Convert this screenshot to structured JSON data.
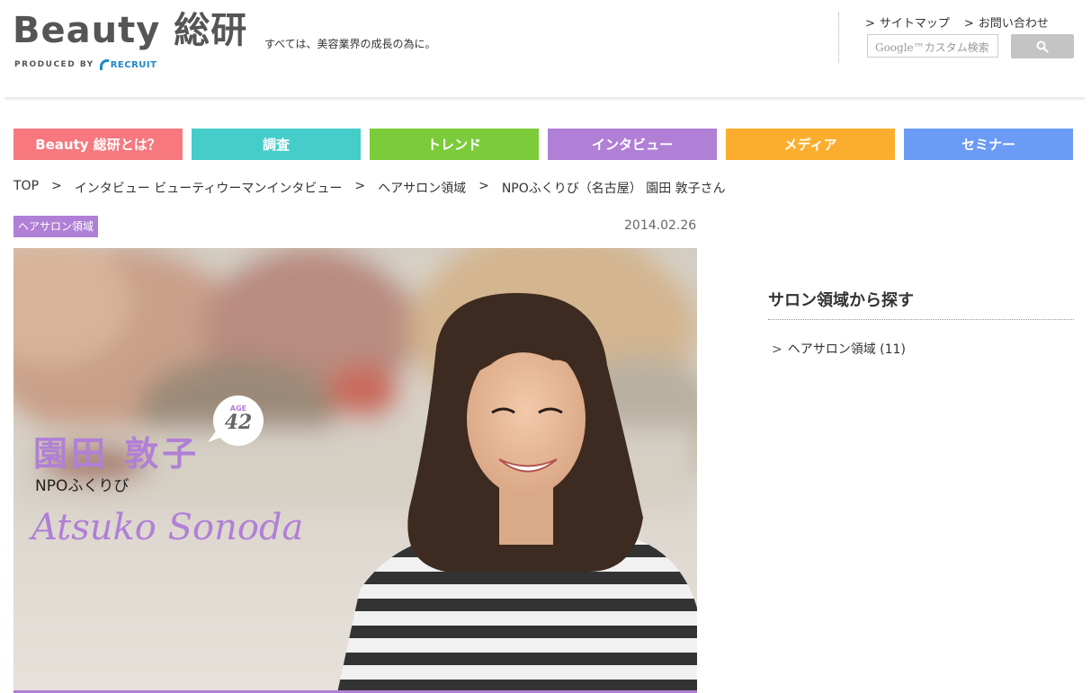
{
  "header": {
    "logo": "Beauty 総研",
    "produced_by": "PRODUCED BY",
    "recruit": "RECRUIT",
    "tagline": "すべては、美容業界の成長の為に。",
    "links": [
      {
        "arrow": ">",
        "label": "サイトマップ"
      },
      {
        "arrow": ">",
        "label": "お問い合わせ"
      }
    ],
    "search_placeholder": "Google™カスタム検索",
    "search_icon": "search-icon"
  },
  "nav": [
    {
      "label": "Beauty 総研とは？",
      "color": "#f7787f"
    },
    {
      "label": "調査",
      "color": "#45cdc9"
    },
    {
      "label": "トレンド",
      "color": "#7ccb3a"
    },
    {
      "label": "インタビュー",
      "color": "#b07fd6"
    },
    {
      "label": "メディア",
      "color": "#fbae2d"
    },
    {
      "label": "セミナー",
      "color": "#6b9bf5"
    }
  ],
  "breadcrumb": {
    "items": [
      "TOP",
      "インタビュー ビューティウーマンインタビュー",
      "ヘアサロン領域",
      "NPOふくりび（名古屋） 園田 敦子さん"
    ],
    "separator": ">"
  },
  "article": {
    "category": "ヘアサロン領域",
    "date": "2014.02.26",
    "age_label": "AGE",
    "age": "42",
    "name_jp": "園田 敦子",
    "org": "NPOふくりび",
    "name_en": "Atsuko Sonoda",
    "accent_color": "#b07fd6"
  },
  "sidebar": {
    "title": "サロン領域から探す",
    "links": [
      {
        "chevron": ">",
        "label": "ヘアサロン領域 (11)"
      }
    ]
  }
}
